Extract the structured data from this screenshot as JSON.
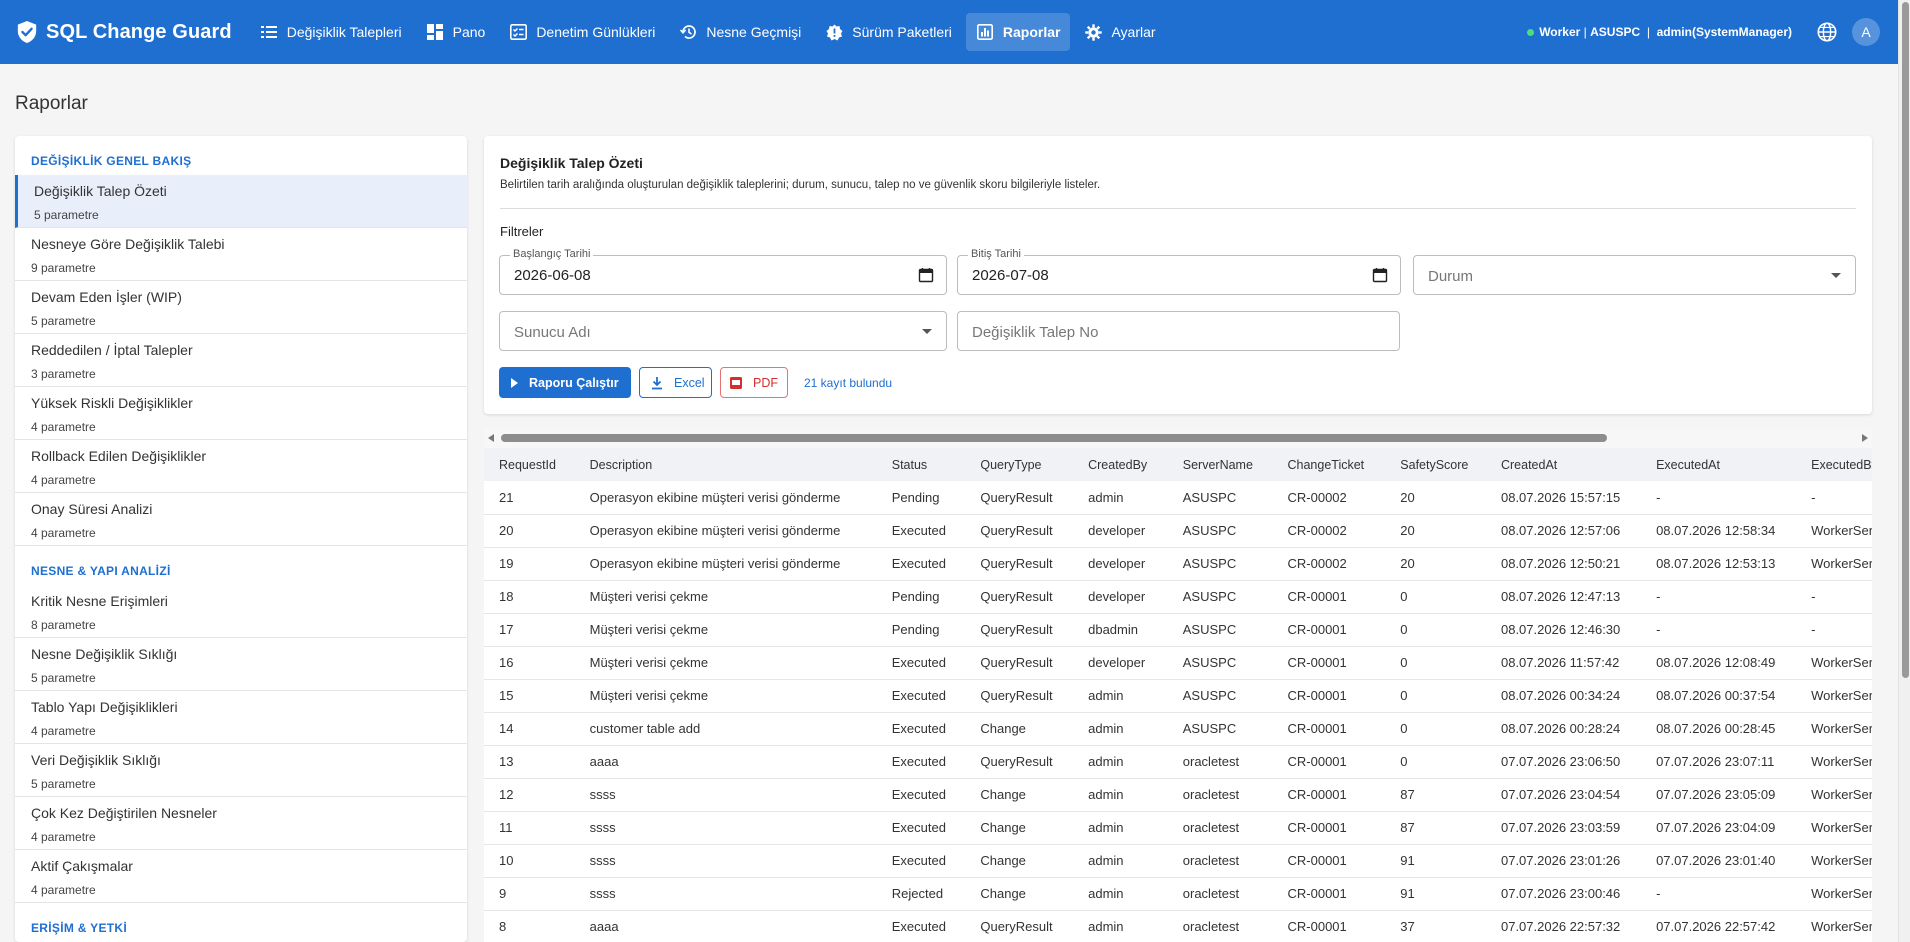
{
  "brand": {
    "name": "SQL Change Guard"
  },
  "nav": [
    {
      "label": "Değişiklik Talepleri",
      "icon": "list-icon",
      "active": false
    },
    {
      "label": "Pano",
      "icon": "dashboard-icon",
      "active": false
    },
    {
      "label": "Denetim Günlükleri",
      "icon": "checklist-icon",
      "active": false
    },
    {
      "label": "Nesne Geçmişi",
      "icon": "history-icon",
      "active": false
    },
    {
      "label": "Sürüm Paketleri",
      "icon": "badge-icon",
      "active": false
    },
    {
      "label": "Raporlar",
      "icon": "chart-icon",
      "active": true
    },
    {
      "label": "Ayarlar",
      "icon": "gear-icon",
      "active": false
    }
  ],
  "topright": {
    "worker": "Worker",
    "sep1": "|",
    "server": "ASUSPC",
    "sep2": "|",
    "user": "admin(SystemManager)",
    "avatar": "A"
  },
  "page": {
    "title": "Raporlar"
  },
  "sidebar": {
    "sections": [
      {
        "title": "DEĞİŞİKLİK GENEL BAKIŞ",
        "items": [
          {
            "label": "Değişiklik Talep Özeti",
            "sub": "5 parametre",
            "active": true
          },
          {
            "label": "Nesneye Göre Değişiklik Talebi",
            "sub": "9 parametre"
          },
          {
            "label": "Devam Eden İşler (WIP)",
            "sub": "5 parametre"
          },
          {
            "label": "Reddedilen / İptal Talepler",
            "sub": "3 parametre"
          },
          {
            "label": "Yüksek Riskli Değişiklikler",
            "sub": "4 parametre"
          },
          {
            "label": "Rollback Edilen Değişiklikler",
            "sub": "4 parametre"
          },
          {
            "label": "Onay Süresi Analizi",
            "sub": "4 parametre"
          }
        ]
      },
      {
        "title": "NESNE & YAPI ANALİZİ",
        "items": [
          {
            "label": "Kritik Nesne Erişimleri",
            "sub": "8 parametre"
          },
          {
            "label": "Nesne Değişiklik Sıklığı",
            "sub": "5 parametre"
          },
          {
            "label": "Tablo Yapı Değişiklikleri",
            "sub": "4 parametre"
          },
          {
            "label": "Veri Değişiklik Sıklığı",
            "sub": "5 parametre"
          },
          {
            "label": "Çok Kez Değiştirilen Nesneler",
            "sub": "4 parametre"
          },
          {
            "label": "Aktif Çakışmalar",
            "sub": "4 parametre"
          }
        ]
      },
      {
        "title": "ERİŞİM & YETKİ",
        "items": []
      }
    ]
  },
  "report": {
    "title": "Değişiklik Talep Özeti",
    "description": "Belirtilen tarih aralığında oluşturulan değişiklik taleplerini; durum, sunucu, talep no ve güvenlik skoru bilgileriyle listeler.",
    "filters_label": "Filtreler",
    "start_label": "Başlangıç Tarihi",
    "start_value": "2026-06-08",
    "end_label": "Bitiş Tarihi",
    "end_value": "2026-07-08",
    "status_placeholder": "Durum",
    "server_placeholder": "Sunucu Adı",
    "ticket_placeholder": "Değişiklik Talep No",
    "run_label": "Raporu Çalıştır",
    "excel_label": "Excel",
    "pdf_label": "PDF",
    "found_text": "21 kayıt bulundu"
  },
  "table": {
    "columns": [
      "RequestId",
      "Description",
      "Status",
      "QueryType",
      "CreatedBy",
      "ServerName",
      "ChangeTicket",
      "SafetyScore",
      "CreatedAt",
      "ExecutedAt",
      "ExecutedBy"
    ],
    "rows": [
      [
        "21",
        "Operasyon ekibine müşteri verisi gönderme",
        "Pending",
        "QueryResult",
        "admin",
        "ASUSPC",
        "CR-00002",
        "20",
        "08.07.2026 15:57:15",
        "-",
        "-"
      ],
      [
        "20",
        "Operasyon ekibine müşteri verisi gönderme",
        "Executed",
        "QueryResult",
        "developer",
        "ASUSPC",
        "CR-00002",
        "20",
        "08.07.2026 12:57:06",
        "08.07.2026 12:58:34",
        "WorkerService"
      ],
      [
        "19",
        "Operasyon ekibine müşteri verisi gönderme",
        "Executed",
        "QueryResult",
        "developer",
        "ASUSPC",
        "CR-00002",
        "20",
        "08.07.2026 12:50:21",
        "08.07.2026 12:53:13",
        "WorkerService"
      ],
      [
        "18",
        "Müşteri verisi çekme",
        "Pending",
        "QueryResult",
        "developer",
        "ASUSPC",
        "CR-00001",
        "0",
        "08.07.2026 12:47:13",
        "-",
        "-"
      ],
      [
        "17",
        "Müşteri verisi çekme",
        "Pending",
        "QueryResult",
        "dbadmin",
        "ASUSPC",
        "CR-00001",
        "0",
        "08.07.2026 12:46:30",
        "-",
        "-"
      ],
      [
        "16",
        "Müşteri verisi çekme",
        "Executed",
        "QueryResult",
        "developer",
        "ASUSPC",
        "CR-00001",
        "0",
        "08.07.2026 11:57:42",
        "08.07.2026 12:08:49",
        "WorkerService"
      ],
      [
        "15",
        "Müşteri verisi çekme",
        "Executed",
        "QueryResult",
        "admin",
        "ASUSPC",
        "CR-00001",
        "0",
        "08.07.2026 00:34:24",
        "08.07.2026 00:37:54",
        "WorkerService"
      ],
      [
        "14",
        "customer table add",
        "Executed",
        "Change",
        "admin",
        "ASUSPC",
        "CR-00001",
        "0",
        "08.07.2026 00:28:24",
        "08.07.2026 00:28:45",
        "WorkerService"
      ],
      [
        "13",
        "aaaa",
        "Executed",
        "QueryResult",
        "admin",
        "oracletest",
        "CR-00001",
        "0",
        "07.07.2026 23:06:50",
        "07.07.2026 23:07:11",
        "WorkerService"
      ],
      [
        "12",
        "ssss",
        "Executed",
        "Change",
        "admin",
        "oracletest",
        "CR-00001",
        "87",
        "07.07.2026 23:04:54",
        "07.07.2026 23:05:09",
        "WorkerService"
      ],
      [
        "11",
        "ssss",
        "Executed",
        "Change",
        "admin",
        "oracletest",
        "CR-00001",
        "87",
        "07.07.2026 23:03:59",
        "07.07.2026 23:04:09",
        "WorkerService"
      ],
      [
        "10",
        "ssss",
        "Executed",
        "Change",
        "admin",
        "oracletest",
        "CR-00001",
        "91",
        "07.07.2026 23:01:26",
        "07.07.2026 23:01:40",
        "WorkerService"
      ],
      [
        "9",
        "ssss",
        "Rejected",
        "Change",
        "admin",
        "oracletest",
        "CR-00001",
        "91",
        "07.07.2026 23:00:46",
        "-",
        "WorkerService"
      ],
      [
        "8",
        "aaaa",
        "Executed",
        "QueryResult",
        "admin",
        "oracletest",
        "CR-00001",
        "37",
        "07.07.2026 22:57:32",
        "07.07.2026 22:57:42",
        "WorkerService"
      ]
    ]
  },
  "colors": {
    "primary": "#1f6fd1",
    "status_dot": "#4ade80",
    "pdf": "#d32f2f"
  }
}
